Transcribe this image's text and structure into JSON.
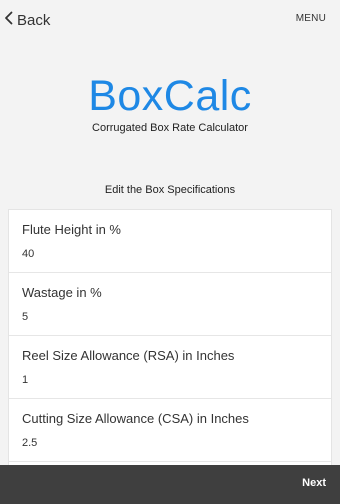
{
  "topbar": {
    "back_label": "Back",
    "menu_label": "MENU"
  },
  "header": {
    "logo": "BoxCalc",
    "tagline": "Corrugated Box Rate Calculator"
  },
  "section_title": "Edit the Box Specifications",
  "fields": [
    {
      "label": "Flute Height in %",
      "value": "40"
    },
    {
      "label": "Wastage in %",
      "value": "5"
    },
    {
      "label": "Reel Size Allowance (RSA) in Inches",
      "value": "1"
    },
    {
      "label": "Cutting Size Allowance (CSA) in Inches",
      "value": "2.5"
    }
  ],
  "bottombar": {
    "next_label": "Next"
  },
  "colors": {
    "brand": "#1e88e5",
    "bottom_bar": "#3f3f3f",
    "background": "#f3f3f3"
  },
  "icons": {
    "back": "chevron-left-icon"
  }
}
